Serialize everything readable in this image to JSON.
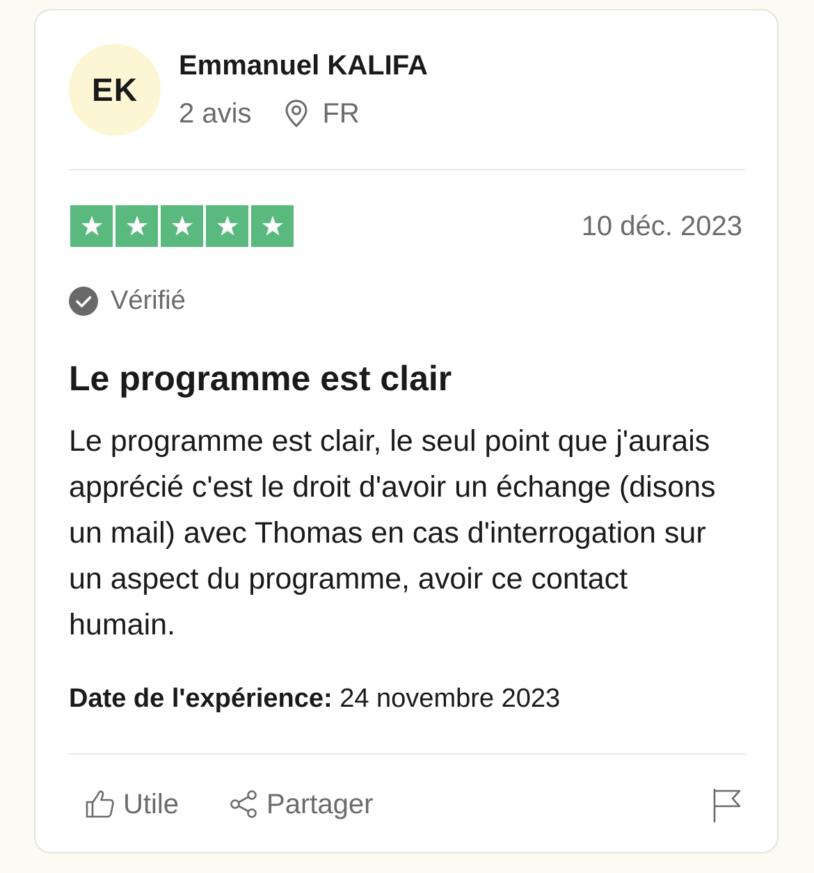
{
  "reviewer": {
    "initials": "EK",
    "name": "Emmanuel KALIFA",
    "review_count": "2 avis",
    "country": "FR"
  },
  "review": {
    "rating": 5,
    "star_color": "#59b97e",
    "date": "10 déc. 2023",
    "verified_label": "Vérifié",
    "title": "Le programme est clair",
    "body": "Le programme est clair, le seul point que j'aurais apprécié c'est le droit d'avoir un échange (disons un mail) avec Thomas en cas d'interrogation sur un aspect du programme, avoir ce contact humain.",
    "experience_label": "Date de l'expérience:",
    "experience_date": "24 novembre 2023"
  },
  "actions": {
    "useful_label": "Utile",
    "share_label": "Partager",
    "useful_icon": "thumbs-up-icon",
    "share_icon": "share-icon",
    "report_icon": "flag-icon"
  }
}
